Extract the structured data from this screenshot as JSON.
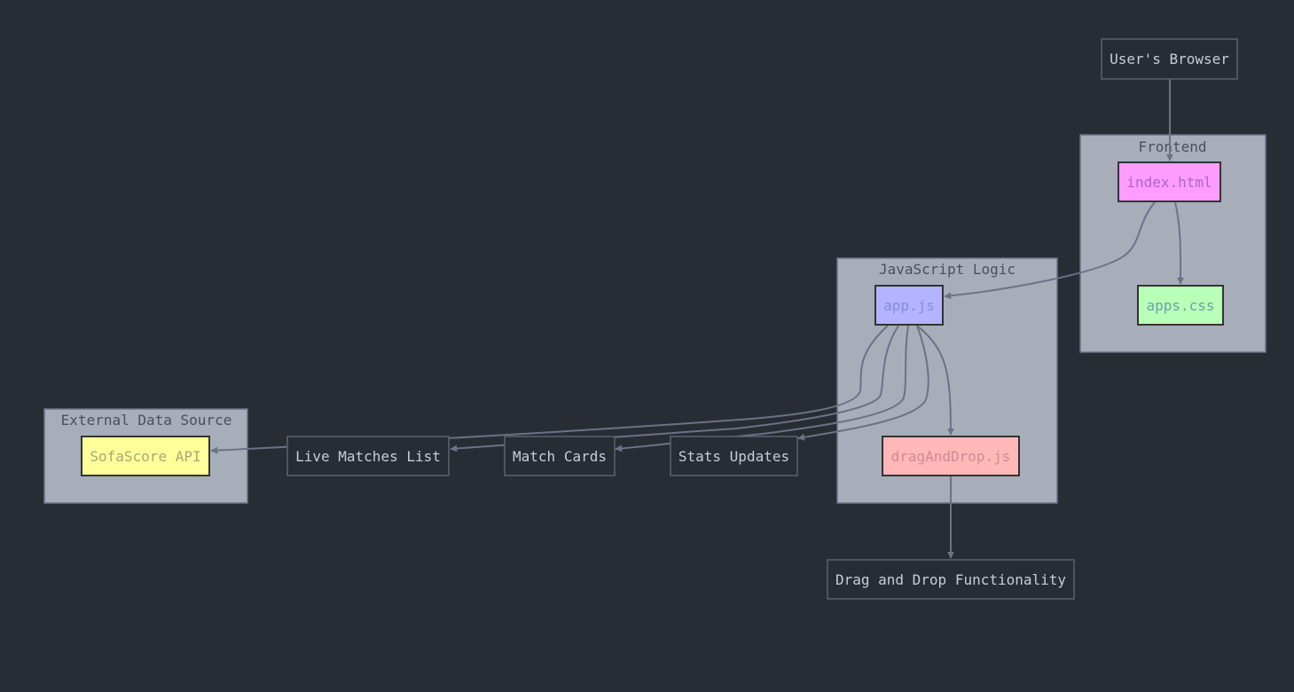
{
  "colors": {
    "background": "#282c34",
    "cluster_fill": "#a7aeba",
    "cluster_stroke": "#6b7285",
    "edge": "#6b7285",
    "plain_node_stroke": "#5d6270",
    "plain_node_text": "#c8cdd6",
    "index_html_fill": "#ff9cff",
    "apps_css_fill": "#b8ffb8",
    "app_js_fill": "#b3b3ff",
    "drag_js_fill": "#ffb8b8",
    "sofascore_fill": "#ffff99"
  },
  "clusters": {
    "frontend": "Frontend",
    "js_logic": "JavaScript Logic",
    "external": "External Data Source"
  },
  "nodes": {
    "browser": "User's Browser",
    "index_html": "index.html",
    "apps_css": "apps.css",
    "app_js": "app.js",
    "drag_js": "dragAndDrop.js",
    "sofascore": "SofaScore API",
    "live_matches": "Live Matches List",
    "match_cards": "Match Cards",
    "stats_updates": "Stats Updates",
    "dnd_func": "Drag and Drop Functionality"
  }
}
